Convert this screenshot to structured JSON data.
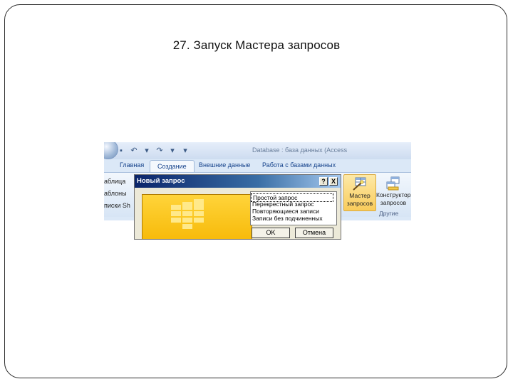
{
  "slide": {
    "title": "27. Запуск  Мастера запросов"
  },
  "app": {
    "window_title": "Database : база данных (Access",
    "qat": [
      {
        "name": "save-icon",
        "glyph": "▪"
      },
      {
        "name": "undo-icon",
        "glyph": "↶"
      },
      {
        "name": "undo-arrow-icon",
        "glyph": "▾"
      },
      {
        "name": "redo-icon",
        "glyph": "↷"
      },
      {
        "name": "redo-arrow-icon",
        "glyph": "▾"
      },
      {
        "name": "customize-qat-icon",
        "glyph": "▾"
      }
    ],
    "tabs": [
      "Главная",
      "Создание",
      "Внешние данные",
      "Работа с базами данных"
    ],
    "active_tab": "Создание",
    "left_group": [
      "аблица",
      "аблоны",
      "писки Sh"
    ],
    "buttons": [
      {
        "label_line1": "Мастер",
        "label_line2": "запросов",
        "highlighted": true,
        "icon": "query-wizard-icon"
      },
      {
        "label_line1": "Конструктор",
        "label_line2": "запросов",
        "highlighted": false,
        "icon": "query-designer-icon"
      }
    ],
    "group_label": "Другие"
  },
  "dialog": {
    "title": "Новый запрос",
    "help_glyph": "?",
    "close_glyph": "X",
    "options": [
      "Простой запрос",
      "Перекрестный запрос",
      "Повторяющиеся записи",
      "Записи без подчиненных"
    ],
    "selected_index": 0,
    "ok_label": "OK",
    "cancel_label": "Отмена"
  },
  "colors": {
    "ribbon_text": "#15428b",
    "dialog_title_start": "#0a246a",
    "highlight": "#f9cc5b",
    "preview_fill": "#f5b500"
  }
}
